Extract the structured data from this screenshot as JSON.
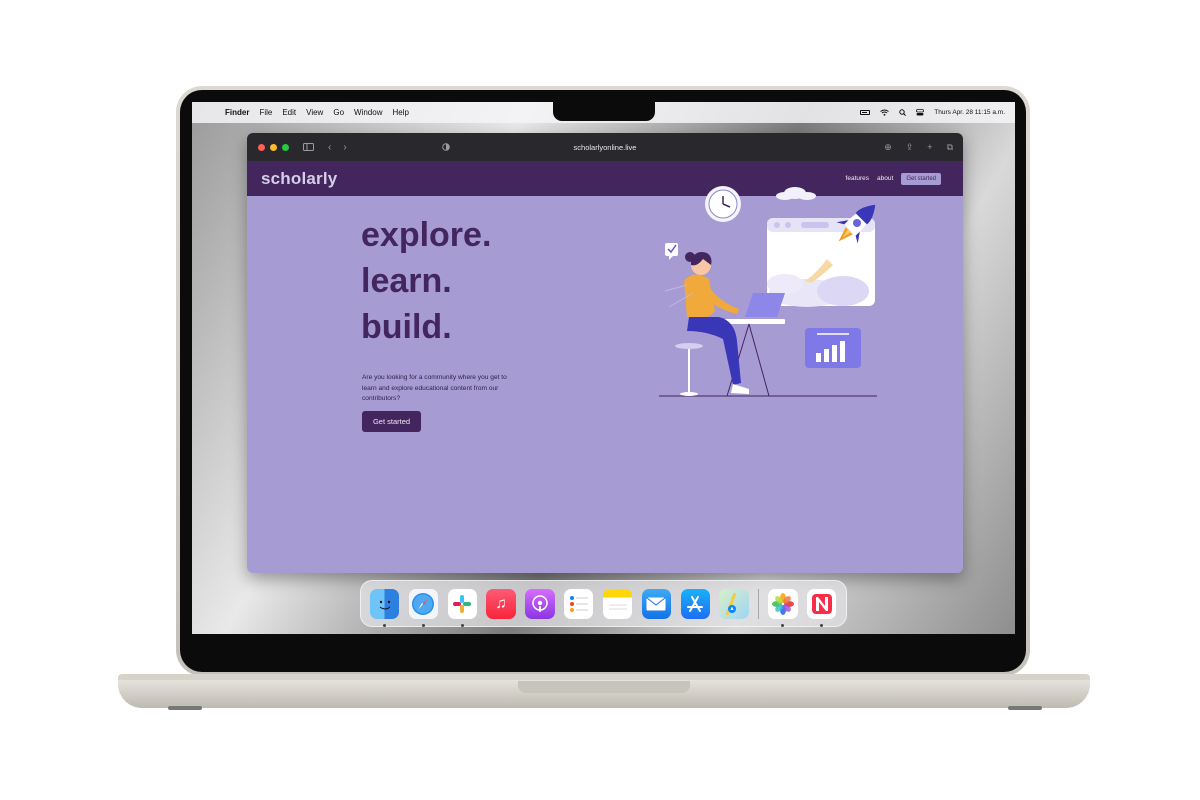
{
  "menubar": {
    "apple_glyph": "",
    "app_name": "Finder",
    "items": [
      "File",
      "Edit",
      "View",
      "Go",
      "Window",
      "Help"
    ],
    "clock": "Thurs Apr. 28 11:15 a.m."
  },
  "browser": {
    "url": "scholarlyonline.live"
  },
  "site": {
    "logo": "scholarly",
    "nav": {
      "features": "features",
      "about": "about",
      "get_started": "Get started"
    },
    "hero": {
      "line1": "explore.",
      "line2": "learn.",
      "line3": "build.",
      "description": "Are you looking for a community where you get to learn and explore educational content from our contributors?",
      "cta": "Get started"
    },
    "colors": {
      "primary": "#43265e",
      "background": "#a69bd3",
      "accent": "#5b54d6"
    }
  },
  "dock": {
    "apps": [
      "finder-icon",
      "safari-icon",
      "slack-icon",
      "music-icon",
      "podcasts-icon",
      "reminders-icon",
      "notes-icon",
      "mail-icon",
      "app-store-icon",
      "maps-icon",
      "photos-icon",
      "news-icon"
    ]
  }
}
